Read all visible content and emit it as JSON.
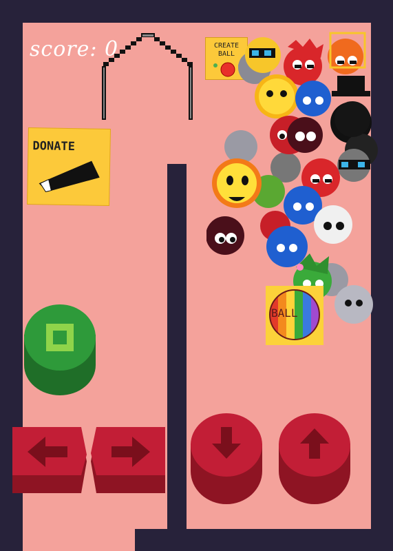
{
  "hud": {
    "score_label": "score: 0"
  },
  "donate": {
    "label": "DONATE"
  },
  "create_ball": {
    "label": "CREATE BALL"
  },
  "rainbow_ball": {
    "label": "BALL"
  },
  "controls": {
    "action": "action-button",
    "left": "move-left",
    "right": "move-right",
    "down": "drop-down",
    "up": "jump-up"
  },
  "colors": {
    "playfield": "#f4a29b",
    "wall": "#27223a",
    "green_button": "#2e9a3a",
    "red_button": "#c21e36",
    "sticky_note": "#fcc93a"
  }
}
